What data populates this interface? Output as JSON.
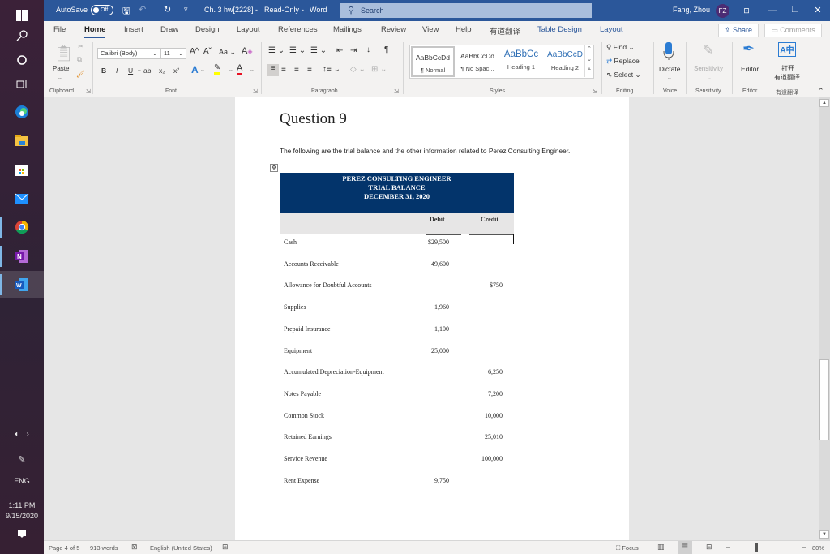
{
  "taskbar": {
    "icons": [
      "windows-start",
      "search",
      "cortana",
      "task-view",
      "edge",
      "file-explorer",
      "store",
      "mail",
      "chrome",
      "onenote",
      "word"
    ],
    "tray": {
      "language": "ENG",
      "time": "1:11 PM",
      "date": "9/15/2020"
    }
  },
  "titlebar": {
    "autosave_label": "AutoSave",
    "autosave_state": "Off",
    "doc_title": "Ch. 3 hw[2228]",
    "mode": "Read-Only",
    "app": "Word",
    "search_placeholder": "Search",
    "user_name": "Fang, Zhou",
    "user_initials": "FZ",
    "sep": "-"
  },
  "tabs": [
    {
      "label": "File"
    },
    {
      "label": "Home",
      "active": true
    },
    {
      "label": "Insert"
    },
    {
      "label": "Draw"
    },
    {
      "label": "Design"
    },
    {
      "label": "Layout"
    },
    {
      "label": "References"
    },
    {
      "label": "Mailings"
    },
    {
      "label": "Review"
    },
    {
      "label": "View"
    },
    {
      "label": "Help"
    },
    {
      "label": "有道翻译"
    },
    {
      "label": "Table Design",
      "contextual": true
    },
    {
      "label": "Layout",
      "contextual": true
    }
  ],
  "share_label": "Share",
  "comments_label": "Comments",
  "ribbon": {
    "clipboard": {
      "label": "Clipboard",
      "paste": "Paste"
    },
    "font": {
      "label": "Font",
      "font_name": "Calibri (Body)",
      "font_size": "11",
      "case": "Aa"
    },
    "paragraph": {
      "label": "Paragraph"
    },
    "styles": {
      "label": "Styles",
      "items": [
        {
          "preview": "AaBbCcDd",
          "name": "¶ Normal"
        },
        {
          "preview": "AaBbCcDd",
          "name": "¶ No Spac..."
        },
        {
          "preview": "AaBbCc",
          "name": "Heading 1"
        },
        {
          "preview": "AaBbCcD",
          "name": "Heading 2"
        }
      ]
    },
    "editing": {
      "label": "Editing",
      "find": "Find",
      "replace": "Replace",
      "select": "Select"
    },
    "voice": {
      "label": "Voice",
      "dictate": "Dictate"
    },
    "sensitivity": {
      "label": "Sensitivity",
      "button": "Sensitivity"
    },
    "editor": {
      "label": "Editor",
      "button": "Editor"
    },
    "youdao": {
      "label": "有道翻译",
      "button_line1": "打开",
      "button_line2": "有道翻译"
    }
  },
  "document": {
    "heading": "Question 9",
    "intro": "The following are the trial balance and the other information related to Perez Consulting Engineer.",
    "table": {
      "title_lines": [
        "PEREZ CONSULTING ENGINEER",
        "TRIAL BALANCE",
        "DECEMBER 31, 2020"
      ],
      "col_debit": "Debit",
      "col_credit": "Credit",
      "rows": [
        {
          "account": "Cash",
          "debit": "$29,500",
          "credit": ""
        },
        {
          "account": "Accounts Receivable",
          "debit": "49,600",
          "credit": ""
        },
        {
          "account": "Allowance for Doubtful Accounts",
          "debit": "",
          "credit": "$750"
        },
        {
          "account": "Supplies",
          "debit": "1,960",
          "credit": ""
        },
        {
          "account": "Prepaid Insurance",
          "debit": "1,100",
          "credit": ""
        },
        {
          "account": "Equipment",
          "debit": "25,000",
          "credit": ""
        },
        {
          "account": "Accumulated Depreciation-Equipment",
          "debit": "",
          "credit": "6,250"
        },
        {
          "account": "Notes Payable",
          "debit": "",
          "credit": "7,200"
        },
        {
          "account": "Common Stock",
          "debit": "",
          "credit": "10,000"
        },
        {
          "account": "Retained Earnings",
          "debit": "",
          "credit": "25,010"
        },
        {
          "account": "Service Revenue",
          "debit": "",
          "credit": "100,000"
        },
        {
          "account": "Rent Expense",
          "debit": "9,750",
          "credit": ""
        }
      ]
    }
  },
  "statusbar": {
    "page": "Page 4 of 5",
    "words": "913 words",
    "language": "English (United States)",
    "focus": "Focus",
    "zoom": "80%"
  }
}
